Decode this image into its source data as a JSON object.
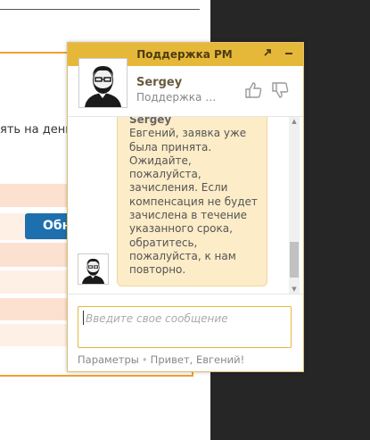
{
  "background_page": {
    "text_fragment": "ять на деньг",
    "button_fragment": "Обн",
    "colors": {
      "orange_border": "#f0a030",
      "band_light": "#fff0e6",
      "band_dark": "#fde1d0",
      "button": "#1e6fae",
      "dark_panel": "#262626"
    }
  },
  "chat": {
    "title": "Поддержка PM",
    "expand_icon": "expand-arrow-icon",
    "minimize_icon": "minimize-icon",
    "agent": {
      "name": "Sergey",
      "role": "Поддержка клиентов",
      "avatar_icon": "bearded-agent-avatar-icon",
      "like_icon": "thumb-up-icon",
      "dislike_icon": "thumb-down-icon"
    },
    "messages": [
      {
        "sender": "Sergey",
        "text": "Евгений, заявка уже была принята. Ожидайте, пожалуйста, зачисления. Если компенсация не будет зачислена в течение указанного срока, обратитесь, пожалуйста, к нам повторно."
      }
    ],
    "input": {
      "placeholder": "Введите свое сообщение",
      "value": ""
    },
    "footer": {
      "settings_label": "Параметры",
      "separator": "•",
      "greeting": "Привет, Евгений!"
    },
    "colors": {
      "header": "#e6b83a",
      "bubble": "#fcecc7",
      "bubble_border": "#f0d59b"
    }
  }
}
